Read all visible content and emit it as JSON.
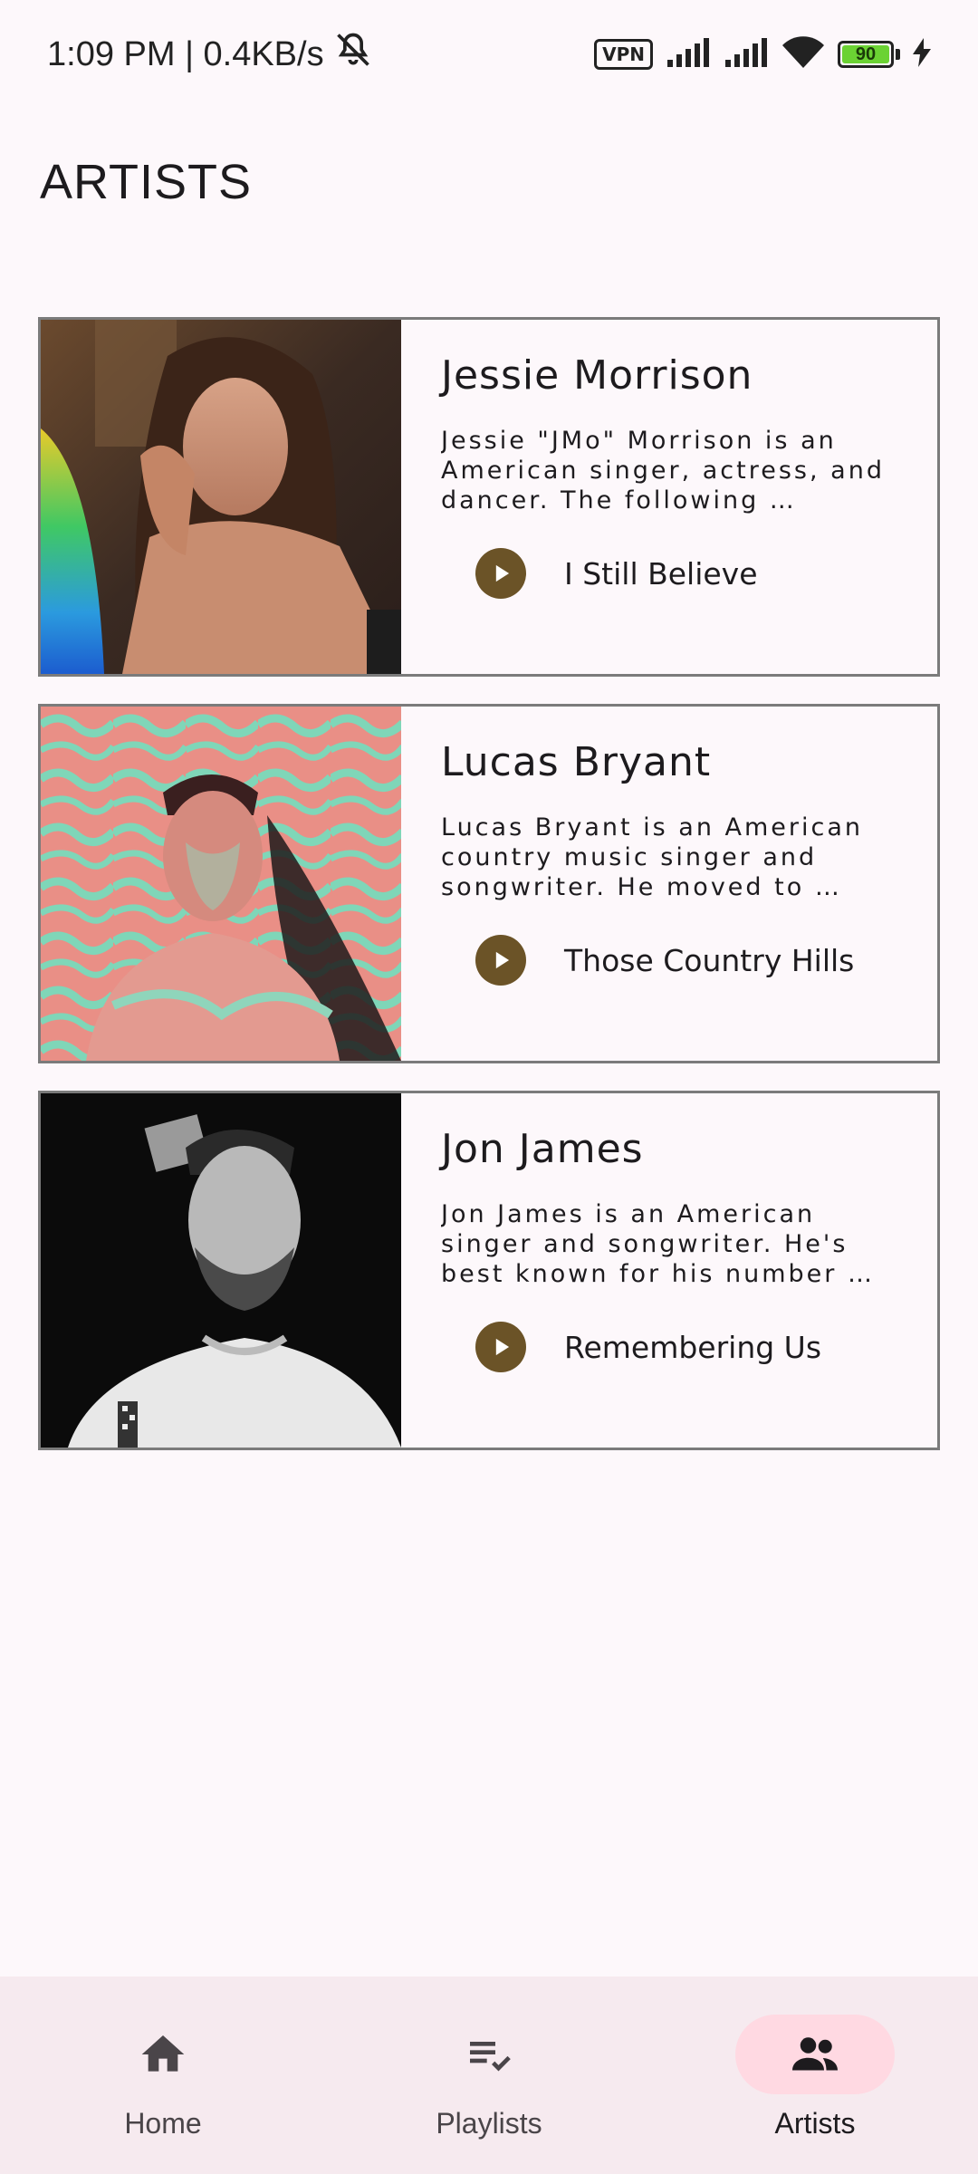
{
  "status_bar": {
    "time_speed": "1:09 PM | 0.4KB/s",
    "vpn": "VPN",
    "battery": "90"
  },
  "page": {
    "title": "ARTISTS"
  },
  "artists": [
    {
      "name": "Jessie Morrison",
      "description": "Jessie \"JMo\" Morrison is an American singer, actress, and dancer. The following …",
      "song": "I Still Believe"
    },
    {
      "name": "Lucas Bryant",
      "description": "Lucas Bryant is an American country music singer and songwriter. He moved to …",
      "song": "Those Country Hills"
    },
    {
      "name": "Jon James",
      "description": "Jon James is an American singer and songwriter. He's best known for his number …",
      "song": "Remembering Us"
    }
  ],
  "nav": {
    "items": [
      {
        "label": "Home",
        "icon": "home-icon",
        "active": false
      },
      {
        "label": "Playlists",
        "icon": "playlist-check-icon",
        "active": false
      },
      {
        "label": "Artists",
        "icon": "people-icon",
        "active": true
      }
    ]
  },
  "colors": {
    "accent_play": "#6b5327",
    "nav_active_pill": "#ffd9e2",
    "background": "#fdf8fb"
  }
}
